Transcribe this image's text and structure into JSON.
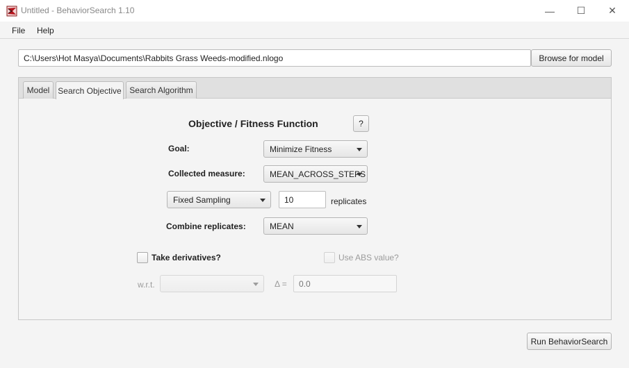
{
  "window": {
    "title": "Untitled - BehaviorSearch 1.10",
    "minimize_glyph": "—",
    "maximize_glyph": "☐",
    "close_glyph": "✕"
  },
  "menu": {
    "file": "File",
    "help": "Help"
  },
  "model_path": {
    "value": "C:\\Users\\Hot Masya\\Documents\\Rabbits Grass Weeds-modified.nlogo",
    "browse_label": "Browse for model"
  },
  "tabs": [
    {
      "label": "Model",
      "active": false
    },
    {
      "label": "Search Objective",
      "active": true
    },
    {
      "label": "Search Algorithm",
      "active": false
    }
  ],
  "objective": {
    "heading": "Objective / Fitness Function",
    "help_label": "?",
    "goal_label": "Goal:",
    "goal_value": "Minimize Fitness",
    "measure_label": "Collected measure:",
    "measure_value": "MEAN_ACROSS_STEPS",
    "sampling_value": "Fixed Sampling",
    "replicates_count": "10",
    "replicates_label": "replicates",
    "combine_label": "Combine replicates:",
    "combine_value": "MEAN",
    "derivatives_label": "Take derivatives?",
    "abs_label": "Use ABS value?",
    "wrt_label": "w.r.t.",
    "wrt_value": "",
    "delta_label": "Δ =",
    "delta_placeholder": "0.0"
  },
  "run_label": "Run BehaviorSearch",
  "colors": {
    "brand_icon": "#b5121b",
    "background": "#f4f4f4"
  }
}
